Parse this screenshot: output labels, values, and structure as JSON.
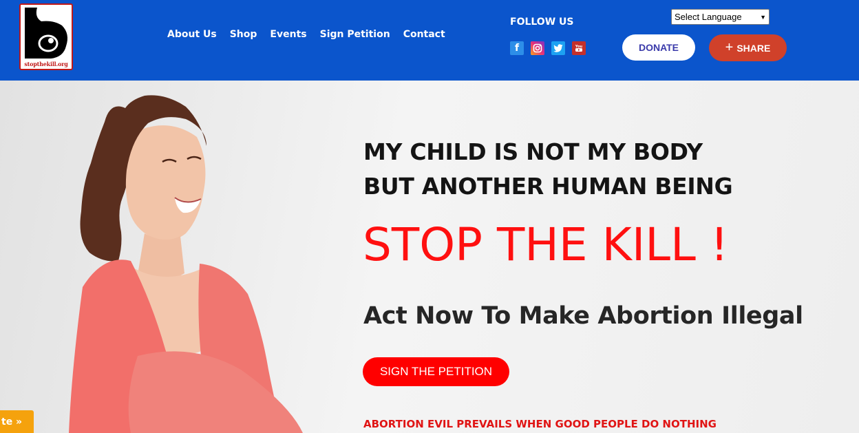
{
  "logo": {
    "text": "stopthekill.org"
  },
  "nav": {
    "items": [
      {
        "label": "About Us"
      },
      {
        "label": "Shop"
      },
      {
        "label": "Events"
      },
      {
        "label": "Sign Petition"
      },
      {
        "label": "Contact"
      }
    ]
  },
  "follow": {
    "label": "FOLLOW US",
    "icons": [
      "facebook-icon",
      "instagram-icon",
      "twitter-icon",
      "youtube-icon"
    ]
  },
  "language": {
    "selected": "Select Language"
  },
  "buttons": {
    "donate": "DONATE",
    "share": "SHARE"
  },
  "hero": {
    "headline_1": "MY CHILD IS NOT MY BODY",
    "headline_2": "BUT ANOTHER HUMAN BEING",
    "stop": "STOP THE KILL !",
    "call_to_action": "Act Now To Make Abortion Illegal",
    "petition_button": "SIGN THE PETITION",
    "tagline": "ABORTION EVIL PREVAILS WHEN GOOD PEOPLE DO NOTHING"
  },
  "translate_tab": {
    "label": "te »"
  },
  "colors": {
    "header_bg": "#0b55cc",
    "accent_red": "#ff0000",
    "share_bg": "#d0412a",
    "translate_tab": "#f5a20d"
  }
}
